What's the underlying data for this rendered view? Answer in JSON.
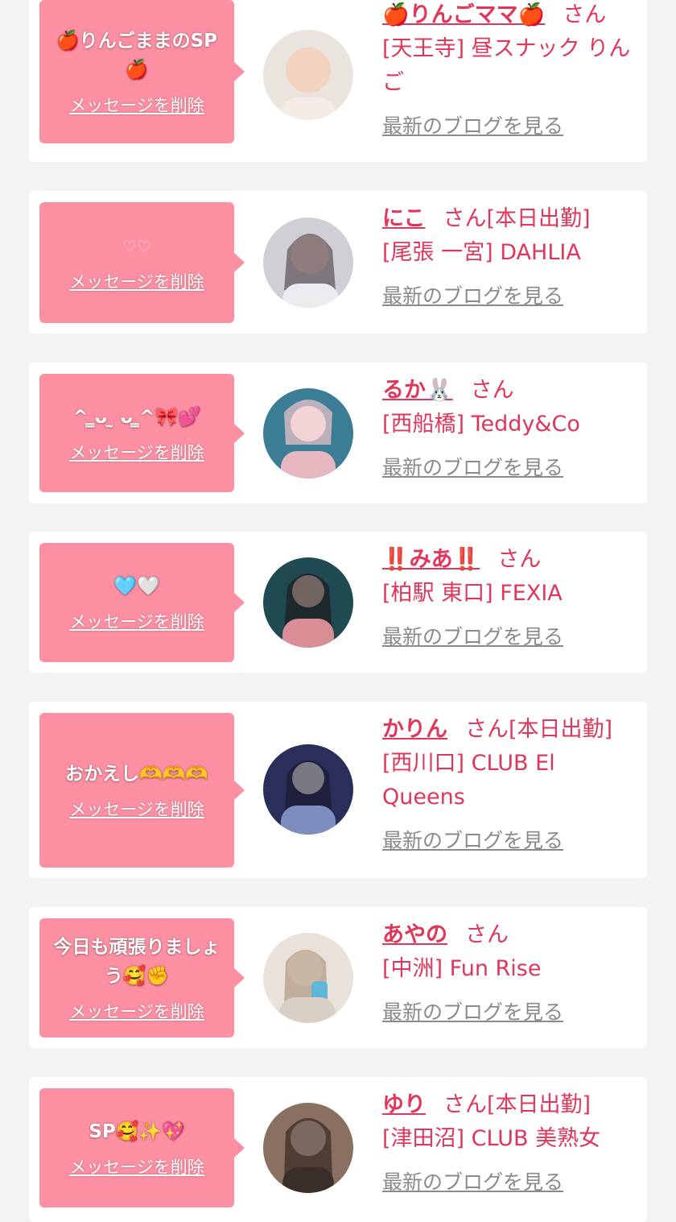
{
  "delete_label": "メッセージを削除",
  "san_label": "さん",
  "blog_label": "最新のブログを見る",
  "entries": [
    {
      "message": "🍎りんごままのSP🍎",
      "name": "🍎りんごママ🍎",
      "status": "",
      "shop": "[天王寺] 昼スナック りんご",
      "avatar": "woman-avatar-icon"
    },
    {
      "message": "♡♡",
      "name": "にこ",
      "status": "[本日出勤]",
      "shop": "[尾張 一宮] DAHLIA",
      "avatar": "woman-avatar-icon"
    },
    {
      "message": "^ ̳ᴗ ̫ ᴗ ̳^🎀💕",
      "name": "るか🐰",
      "status": "",
      "shop": "[西船橋] Teddy&Co",
      "avatar": "woman-avatar-icon"
    },
    {
      "message": "🩵🤍",
      "name": "‼️みあ‼️",
      "status": "",
      "shop": "[柏駅 東口] FEXIA",
      "avatar": "woman-avatar-icon"
    },
    {
      "message": "おかえし🫶🫶🫶",
      "name": "かりん",
      "status": "[本日出勤]",
      "shop": "[西川口] CLUB El Queens",
      "avatar": "woman-avatar-icon"
    },
    {
      "message": "今日も頑張りましょう🥰✊",
      "name": "あやの",
      "status": "",
      "shop": "[中洲] Fun Rise",
      "avatar": "woman-avatar-icon"
    },
    {
      "message": "SP🥰✨💖",
      "name": "ゆり",
      "status": "[本日出勤]",
      "shop": "[津田沼] CLUB 美熟女",
      "avatar": "woman-avatar-icon"
    }
  ],
  "colors": {
    "accent": "#e0365a",
    "bubble": "#fd8fa3",
    "link": "#8a8a8a",
    "background": "#f3f3f3"
  }
}
